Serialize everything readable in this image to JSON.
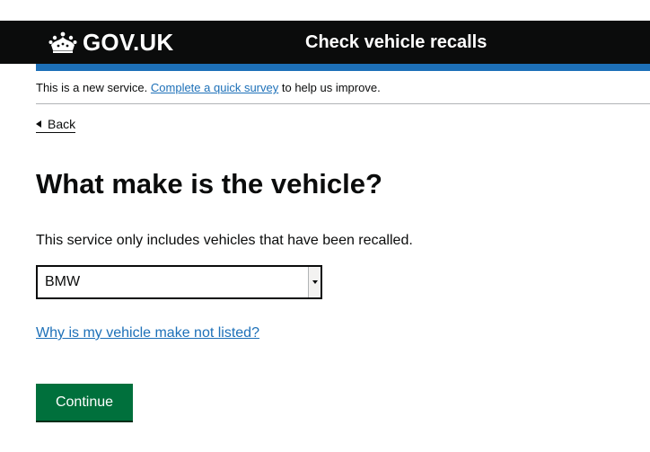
{
  "header": {
    "logo_text": "GOV.UK",
    "service_name": "Check vehicle recalls",
    "crown_icon": "crown-icon"
  },
  "phase_banner": {
    "prefix": "This is a new service.",
    "link": "Complete a quick survey",
    "suffix": "to help us improve."
  },
  "back_link": {
    "label": "Back",
    "icon": "chevron-left-icon"
  },
  "question": {
    "heading": "What make is the vehicle?",
    "hint": "This service only includes vehicles that have been recalled."
  },
  "make_select": {
    "selected_value": "BMW",
    "icon": "chevron-down-icon"
  },
  "help_link": "Why is my vehicle make not listed?",
  "continue_button": "Continue",
  "colors": {
    "header_background": "#0b0c0c",
    "accent_blue": "#1d70b8",
    "button_green": "#00703c"
  }
}
